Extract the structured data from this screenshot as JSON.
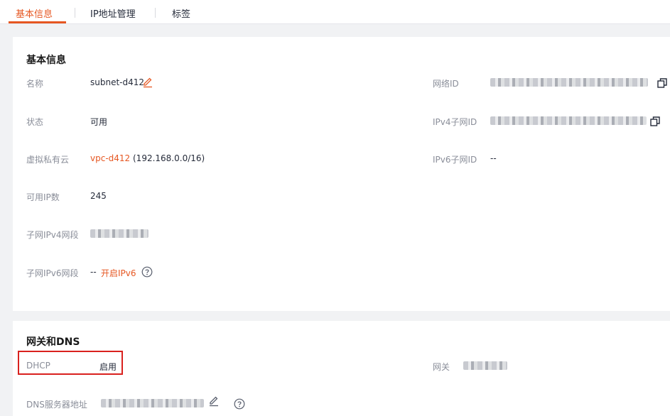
{
  "tabs": [
    "基本信息",
    "IP地址管理",
    "标签"
  ],
  "basic": {
    "title": "基本信息",
    "name_label": "名称",
    "name_value": "subnet-d412",
    "status_label": "状态",
    "status_value": "可用",
    "vpc_label": "虚拟私有云",
    "vpc_link": "vpc-d412",
    "vpc_cidr": "(192.168.0.0/16)",
    "available_ip_label": "可用IP数",
    "available_ip_value": "245",
    "ipv4_cidr_label": "子网IPv4网段",
    "ipv6_cidr_label": "子网IPv6网段",
    "ipv6_cidr_value": "--",
    "enable_ipv6_link": "开启IPv6",
    "network_id_label": "网络ID",
    "ipv4_subnet_id_label": "IPv4子网ID",
    "ipv6_subnet_id_label": "IPv6子网ID",
    "ipv6_subnet_id_value": "--"
  },
  "gateway": {
    "title": "网关和DNS",
    "dhcp_label": "DHCP",
    "dhcp_value": "启用",
    "gateway_label": "网关",
    "dns_label": "DNS服务器地址"
  },
  "colors": {
    "accent": "#e65722",
    "highlight": "#d9211e"
  },
  "icons": [
    "edit-icon",
    "copy-icon",
    "help-icon"
  ]
}
